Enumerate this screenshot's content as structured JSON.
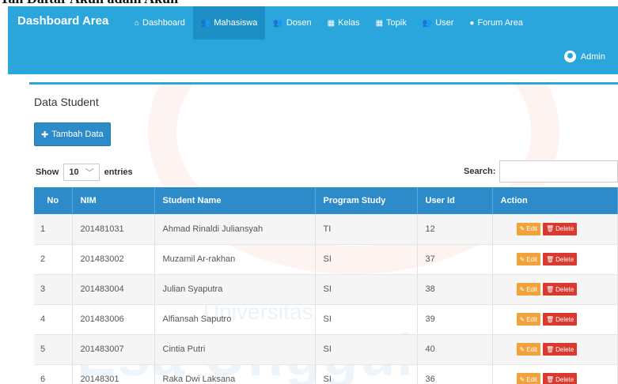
{
  "page_heading_fragment": "Tan Daftar Akun adam Akun",
  "brand": "Dashboard Area",
  "nav": [
    {
      "label": "Dashboard",
      "icon": "home-icon",
      "active": false
    },
    {
      "label": "Mahasiswa",
      "icon": "users-icon",
      "active": true
    },
    {
      "label": "Dosen",
      "icon": "users-icon",
      "active": false
    },
    {
      "label": "Kelas",
      "icon": "table-icon",
      "active": false
    },
    {
      "label": "Topik",
      "icon": "table-icon",
      "active": false
    },
    {
      "label": "User",
      "icon": "users-icon",
      "active": false
    },
    {
      "label": "Forum Area",
      "icon": "comment-icon",
      "active": false
    }
  ],
  "user": {
    "name": "Admin",
    "icon": "user-circle-icon"
  },
  "panel": {
    "title": "Data Student",
    "add_button": "Tambah Data",
    "show_label": "Show",
    "entries_value": "10",
    "entries_label": "entries",
    "search_label": "Search:",
    "search_value": ""
  },
  "table": {
    "headers": [
      "No",
      "NIM",
      "Student Name",
      "Program Study",
      "User Id",
      "Action"
    ],
    "edit_label": "Edit",
    "delete_label": "Delete",
    "rows": [
      {
        "no": "1",
        "nim": "201481031",
        "name": "Ahmad Rinaldi Juliansyah",
        "program": "TI",
        "user_id": "12"
      },
      {
        "no": "2",
        "nim": "201483002",
        "name": "Muzamil Ar-rakhan",
        "program": "SI",
        "user_id": "37"
      },
      {
        "no": "3",
        "nim": "201483004",
        "name": "Julian Syaputra",
        "program": "SI",
        "user_id": "38"
      },
      {
        "no": "4",
        "nim": "201483006",
        "name": "Alfiansah Saputro",
        "program": "SI",
        "user_id": "39"
      },
      {
        "no": "5",
        "nim": "201483007",
        "name": "Cintia Putri",
        "program": "SI",
        "user_id": "40"
      },
      {
        "no": "6",
        "nim": "20148301",
        "name": "Raka Dwi Laksana",
        "program": "SI",
        "user_id": "36"
      }
    ]
  },
  "watermark": {
    "line1": "Universitas",
    "line2": "Esa Unggul"
  },
  "colors": {
    "navbar": "#2aa6dd",
    "primary": "#2e8bc9",
    "edit": "#f2a23a",
    "delete": "#d9392f"
  }
}
